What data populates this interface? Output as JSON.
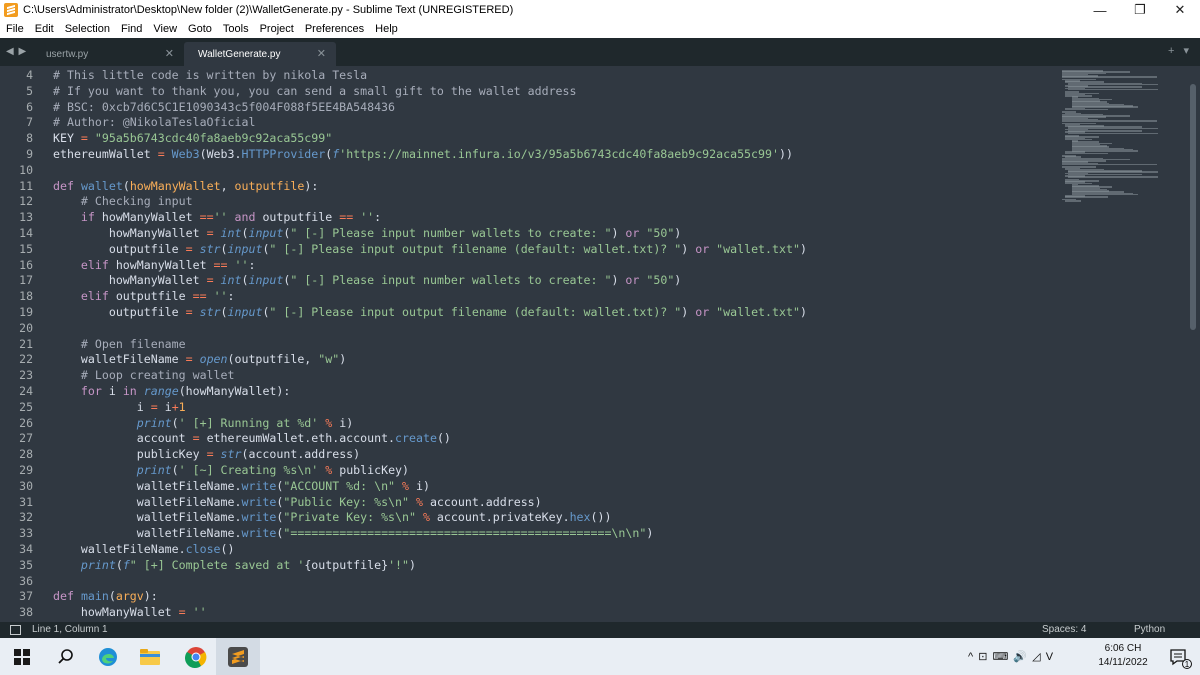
{
  "window": {
    "title": "C:\\Users\\Administrator\\Desktop\\New folder (2)\\WalletGenerate.py - Sublime Text (UNREGISTERED)",
    "minimize": "—",
    "maximize": "❐",
    "close": "✕"
  },
  "menu": [
    "File",
    "Edit",
    "Selection",
    "Find",
    "View",
    "Goto",
    "Tools",
    "Project",
    "Preferences",
    "Help"
  ],
  "tabs": [
    {
      "label": "usertw.py",
      "active": false
    },
    {
      "label": "WalletGenerate.py",
      "active": true
    }
  ],
  "tab_nav": "◀ ▶",
  "tab_close": "✕",
  "tab_plus": "+ ▾",
  "editor": {
    "line_numbers": [
      "4",
      "5",
      "6",
      "7",
      "8",
      "9",
      "10",
      "11",
      "12",
      "13",
      "14",
      "15",
      "16",
      "17",
      "18",
      "19",
      "20",
      "21",
      "22",
      "23",
      "24",
      "25",
      "26",
      "27",
      "28",
      "29",
      "30",
      "31",
      "32",
      "33",
      "34",
      "35",
      "36",
      "37",
      "38"
    ],
    "lines": [
      [
        [
          "c",
          "# This little code is written by nikola Tesla"
        ]
      ],
      [
        [
          "c",
          "# If you want to thank you, you can send a small gift to the wallet address"
        ]
      ],
      [
        [
          "c",
          "# BSC: 0xcb7d6C5C1E1090343c5f004F088f5EE4BA548436"
        ]
      ],
      [
        [
          "c",
          "# Author: @NikolaTeslaOficial"
        ]
      ],
      [
        [
          "t",
          "KEY "
        ],
        [
          "o",
          "="
        ],
        [
          "t",
          " "
        ],
        [
          "s",
          "\"95a5b6743cdc40fa8aeb9c92aca55c99\""
        ]
      ],
      [
        [
          "t",
          "ethereumWallet "
        ],
        [
          "o",
          "="
        ],
        [
          "t",
          " "
        ],
        [
          "f",
          "Web3"
        ],
        [
          "t",
          "(Web3."
        ],
        [
          "f",
          "HTTPProvider"
        ],
        [
          "t",
          "("
        ],
        [
          "fi",
          "f"
        ],
        [
          "s",
          "'https://mainnet.infura.io/v3/95a5b6743cdc40fa8aeb9c92aca55c99'"
        ],
        [
          "t",
          "))"
        ]
      ],
      [],
      [
        [
          "k",
          "def"
        ],
        [
          "t",
          " "
        ],
        [
          "f",
          "wallet"
        ],
        [
          "t",
          "("
        ],
        [
          "v",
          "howManyWallet"
        ],
        [
          "t",
          ", "
        ],
        [
          "v",
          "outputfile"
        ],
        [
          "t",
          "):"
        ]
      ],
      [
        [
          "t",
          "    "
        ],
        [
          "c",
          "# Checking input"
        ]
      ],
      [
        [
          "t",
          "    "
        ],
        [
          "k",
          "if"
        ],
        [
          "t",
          " howManyWallet "
        ],
        [
          "o",
          "=="
        ],
        [
          "s",
          "''"
        ],
        [
          "t",
          " "
        ],
        [
          "k",
          "and"
        ],
        [
          "t",
          " outputfile "
        ],
        [
          "o",
          "=="
        ],
        [
          "t",
          " "
        ],
        [
          "s",
          "''"
        ],
        [
          "t",
          ":"
        ]
      ],
      [
        [
          "t",
          "        howManyWallet "
        ],
        [
          "o",
          "="
        ],
        [
          "t",
          " "
        ],
        [
          "fi",
          "int"
        ],
        [
          "t",
          "("
        ],
        [
          "fi",
          "input"
        ],
        [
          "t",
          "("
        ],
        [
          "s",
          "\" [-] Please input number wallets to create: \""
        ],
        [
          "t",
          ") "
        ],
        [
          "k",
          "or"
        ],
        [
          "t",
          " "
        ],
        [
          "s",
          "\"50\""
        ],
        [
          "t",
          ")"
        ]
      ],
      [
        [
          "t",
          "        outputfile "
        ],
        [
          "o",
          "="
        ],
        [
          "t",
          " "
        ],
        [
          "fi",
          "str"
        ],
        [
          "t",
          "("
        ],
        [
          "fi",
          "input"
        ],
        [
          "t",
          "("
        ],
        [
          "s",
          "\" [-] Please input output filename (default: wallet.txt)? \""
        ],
        [
          "t",
          ") "
        ],
        [
          "k",
          "or"
        ],
        [
          "t",
          " "
        ],
        [
          "s",
          "\"wallet.txt\""
        ],
        [
          "t",
          ")"
        ]
      ],
      [
        [
          "t",
          "    "
        ],
        [
          "k",
          "elif"
        ],
        [
          "t",
          " howManyWallet "
        ],
        [
          "o",
          "=="
        ],
        [
          "t",
          " "
        ],
        [
          "s",
          "''"
        ],
        [
          "t",
          ":"
        ]
      ],
      [
        [
          "t",
          "        howManyWallet "
        ],
        [
          "o",
          "="
        ],
        [
          "t",
          " "
        ],
        [
          "fi",
          "int"
        ],
        [
          "t",
          "("
        ],
        [
          "fi",
          "input"
        ],
        [
          "t",
          "("
        ],
        [
          "s",
          "\" [-] Please input number wallets to create: \""
        ],
        [
          "t",
          ") "
        ],
        [
          "k",
          "or"
        ],
        [
          "t",
          " "
        ],
        [
          "s",
          "\"50\""
        ],
        [
          "t",
          ")"
        ]
      ],
      [
        [
          "t",
          "    "
        ],
        [
          "k",
          "elif"
        ],
        [
          "t",
          " outputfile "
        ],
        [
          "o",
          "=="
        ],
        [
          "t",
          " "
        ],
        [
          "s",
          "''"
        ],
        [
          "t",
          ":"
        ]
      ],
      [
        [
          "t",
          "        outputfile "
        ],
        [
          "o",
          "="
        ],
        [
          "t",
          " "
        ],
        [
          "fi",
          "str"
        ],
        [
          "t",
          "("
        ],
        [
          "fi",
          "input"
        ],
        [
          "t",
          "("
        ],
        [
          "s",
          "\" [-] Please input output filename (default: wallet.txt)? \""
        ],
        [
          "t",
          ") "
        ],
        [
          "k",
          "or"
        ],
        [
          "t",
          " "
        ],
        [
          "s",
          "\"wallet.txt\""
        ],
        [
          "t",
          ")"
        ]
      ],
      [],
      [
        [
          "t",
          "    "
        ],
        [
          "c",
          "# Open filename"
        ]
      ],
      [
        [
          "t",
          "    walletFileName "
        ],
        [
          "o",
          "="
        ],
        [
          "t",
          " "
        ],
        [
          "fi",
          "open"
        ],
        [
          "t",
          "(outputfile, "
        ],
        [
          "s",
          "\"w\""
        ],
        [
          "t",
          ")"
        ]
      ],
      [
        [
          "t",
          "    "
        ],
        [
          "c",
          "# Loop creating wallet"
        ]
      ],
      [
        [
          "t",
          "    "
        ],
        [
          "k",
          "for"
        ],
        [
          "t",
          " i "
        ],
        [
          "k",
          "in"
        ],
        [
          "t",
          " "
        ],
        [
          "fi",
          "range"
        ],
        [
          "t",
          "(howManyWallet):"
        ]
      ],
      [
        [
          "t",
          "            i "
        ],
        [
          "o",
          "="
        ],
        [
          "t",
          " i"
        ],
        [
          "o",
          "+"
        ],
        [
          "n",
          "1"
        ]
      ],
      [
        [
          "t",
          "            "
        ],
        [
          "fi",
          "print"
        ],
        [
          "t",
          "("
        ],
        [
          "s",
          "' [+] Running at %d'"
        ],
        [
          "t",
          " "
        ],
        [
          "o",
          "%"
        ],
        [
          "t",
          " i)"
        ]
      ],
      [
        [
          "t",
          "            account "
        ],
        [
          "o",
          "="
        ],
        [
          "t",
          " ethereumWallet.eth.account."
        ],
        [
          "f",
          "create"
        ],
        [
          "t",
          "()"
        ]
      ],
      [
        [
          "t",
          "            publicKey "
        ],
        [
          "o",
          "="
        ],
        [
          "t",
          " "
        ],
        [
          "fi",
          "str"
        ],
        [
          "t",
          "(account.address)"
        ]
      ],
      [
        [
          "t",
          "            "
        ],
        [
          "fi",
          "print"
        ],
        [
          "t",
          "("
        ],
        [
          "s",
          "' [~] Creating %s\\n'"
        ],
        [
          "t",
          " "
        ],
        [
          "o",
          "%"
        ],
        [
          "t",
          " publicKey)"
        ]
      ],
      [
        [
          "t",
          "            walletFileName."
        ],
        [
          "f",
          "write"
        ],
        [
          "t",
          "("
        ],
        [
          "s",
          "\"ACCOUNT %d: \\n\""
        ],
        [
          "t",
          " "
        ],
        [
          "o",
          "%"
        ],
        [
          "t",
          " i)"
        ]
      ],
      [
        [
          "t",
          "            walletFileName."
        ],
        [
          "f",
          "write"
        ],
        [
          "t",
          "("
        ],
        [
          "s",
          "\"Public Key: %s\\n\""
        ],
        [
          "t",
          " "
        ],
        [
          "o",
          "%"
        ],
        [
          "t",
          " account.address)"
        ]
      ],
      [
        [
          "t",
          "            walletFileName."
        ],
        [
          "f",
          "write"
        ],
        [
          "t",
          "("
        ],
        [
          "s",
          "\"Private Key: %s\\n\""
        ],
        [
          "t",
          " "
        ],
        [
          "o",
          "%"
        ],
        [
          "t",
          " account.privateKey."
        ],
        [
          "f",
          "hex"
        ],
        [
          "t",
          "())"
        ]
      ],
      [
        [
          "t",
          "            walletFileName."
        ],
        [
          "f",
          "write"
        ],
        [
          "t",
          "("
        ],
        [
          "s",
          "\"==============================================\\n\\n\""
        ],
        [
          "t",
          ")"
        ]
      ],
      [
        [
          "t",
          "    walletFileName."
        ],
        [
          "f",
          "close"
        ],
        [
          "t",
          "()"
        ]
      ],
      [
        [
          "t",
          "    "
        ],
        [
          "fi",
          "print"
        ],
        [
          "t",
          "("
        ],
        [
          "fi",
          "f"
        ],
        [
          "s",
          "\" [+] Complete saved at '"
        ],
        [
          "t",
          "{outputfile}"
        ],
        [
          "s",
          "'!\""
        ],
        [
          "t",
          ")"
        ]
      ],
      [],
      [
        [
          "k",
          "def"
        ],
        [
          "t",
          " "
        ],
        [
          "f",
          "main"
        ],
        [
          "t",
          "("
        ],
        [
          "v",
          "argv"
        ],
        [
          "t",
          "):"
        ]
      ],
      [
        [
          "t",
          "    howManyWallet "
        ],
        [
          "o",
          "="
        ],
        [
          "t",
          " "
        ],
        [
          "s",
          "''"
        ]
      ]
    ]
  },
  "statusbar": {
    "position": "Line 1, Column 1",
    "spaces": "Spaces: 4",
    "syntax": "Python"
  },
  "taskbar": {
    "tray_icons": "^  ⊡  ⌨  🔊  ◿  V",
    "time": "6:06 CH",
    "date": "14/11/2022",
    "notification_count": "1"
  }
}
